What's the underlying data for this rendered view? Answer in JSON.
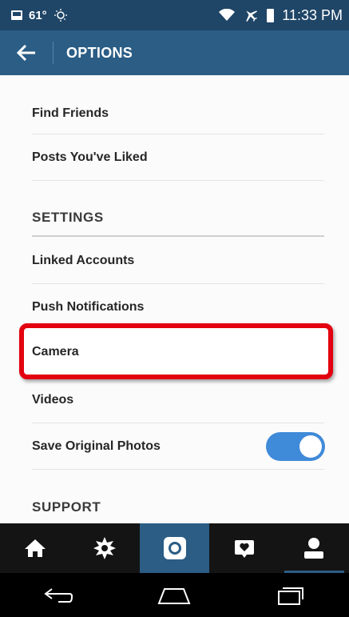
{
  "status_bar": {
    "temperature": "61°",
    "time": "11:33 PM"
  },
  "app_bar": {
    "title": "OPTIONS",
    "back_icon": "arrow-left-icon"
  },
  "menu": {
    "find_friends": "Find Friends",
    "posts_liked": "Posts You've Liked",
    "settings_header": "SETTINGS",
    "linked_accounts": "Linked Accounts",
    "push_notifications": "Push Notifications",
    "camera": "Camera",
    "videos": "Videos",
    "save_original_photos": "Save Original Photos",
    "save_original_photos_enabled": true,
    "support_header": "SUPPORT"
  },
  "tabs": [
    {
      "name": "home",
      "icon": "home-icon"
    },
    {
      "name": "explore",
      "icon": "explore-icon"
    },
    {
      "name": "camera",
      "icon": "camera-icon"
    },
    {
      "name": "activity",
      "icon": "activity-icon"
    },
    {
      "name": "profile",
      "icon": "profile-icon"
    }
  ],
  "colors": {
    "status_bar": "#1f4567",
    "app_bar": "#2b5d85",
    "toggle_on": "#3f8ad9",
    "highlight": "#e3000f"
  }
}
